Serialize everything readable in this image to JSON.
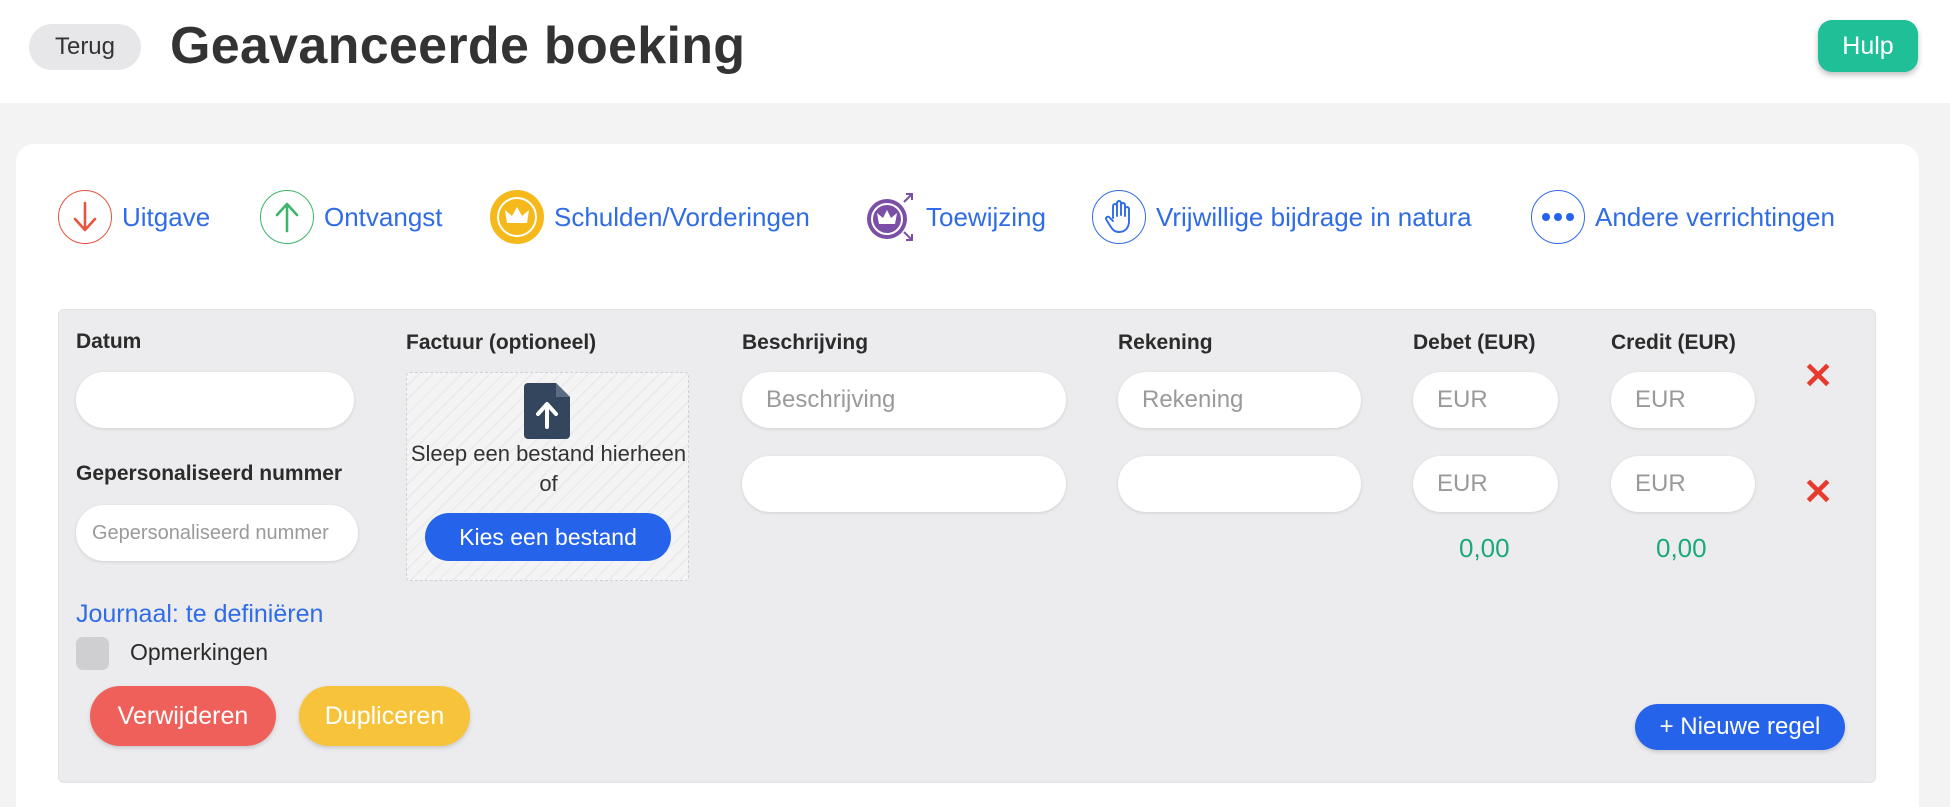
{
  "header": {
    "back_label": "Terug",
    "title": "Geavanceerde boeking",
    "help_label": "Hulp"
  },
  "types": [
    {
      "label": "Uitgave",
      "icon": "arrow-down-icon",
      "color": "#e5553f"
    },
    {
      "label": "Ontvangst",
      "icon": "arrow-up-icon",
      "color": "#3eb56a"
    },
    {
      "label": "Schulden/Vorderingen",
      "icon": "crown-icon",
      "color": "#f2b416"
    },
    {
      "label": "Toewijzing",
      "icon": "crown-transfer-icon",
      "color": "#7b4fa6"
    },
    {
      "label": "Vrijwillige bijdrage in natura",
      "icon": "hand-icon",
      "color": "#2f6ce5"
    },
    {
      "label": "Andere verrichtingen",
      "icon": "more-dots-icon",
      "color": "#2f6ce5"
    }
  ],
  "form": {
    "date_label": "Datum",
    "date_value": "",
    "custom_number_label": "Gepersonaliseerd nummer",
    "custom_number_placeholder": "Gepersonaliseerd nummer",
    "invoice_label": "Factuur (optioneel)",
    "upload_text_1": "Sleep een bestand hierheen",
    "upload_text_2": "of",
    "choose_file_label": "Kies een bestand",
    "description_label": "Beschrijving",
    "account_label": "Rekening",
    "debit_label": "Debet (EUR)",
    "credit_label": "Credit (EUR)",
    "lines": [
      {
        "description_placeholder": "Beschrijving",
        "account_placeholder": "Rekening",
        "debit_placeholder": "EUR",
        "credit_placeholder": "EUR"
      },
      {
        "description_placeholder": "",
        "account_placeholder": "",
        "debit_placeholder": "EUR",
        "credit_placeholder": "EUR"
      }
    ],
    "totals": {
      "debit": "0,00",
      "credit": "0,00"
    },
    "journal_link": "Journaal: te definiëren",
    "remarks_label": "Opmerkingen",
    "delete_label": "Verwijderen",
    "duplicate_label": "Dupliceren",
    "new_line_label": "+ Nieuwe regel"
  },
  "colors": {
    "accent_blue": "#2563eb",
    "help_green": "#1fbf98",
    "delete_red": "#f0605a",
    "duplicate_yellow": "#f6c33a",
    "total_green": "#1aa97a"
  }
}
